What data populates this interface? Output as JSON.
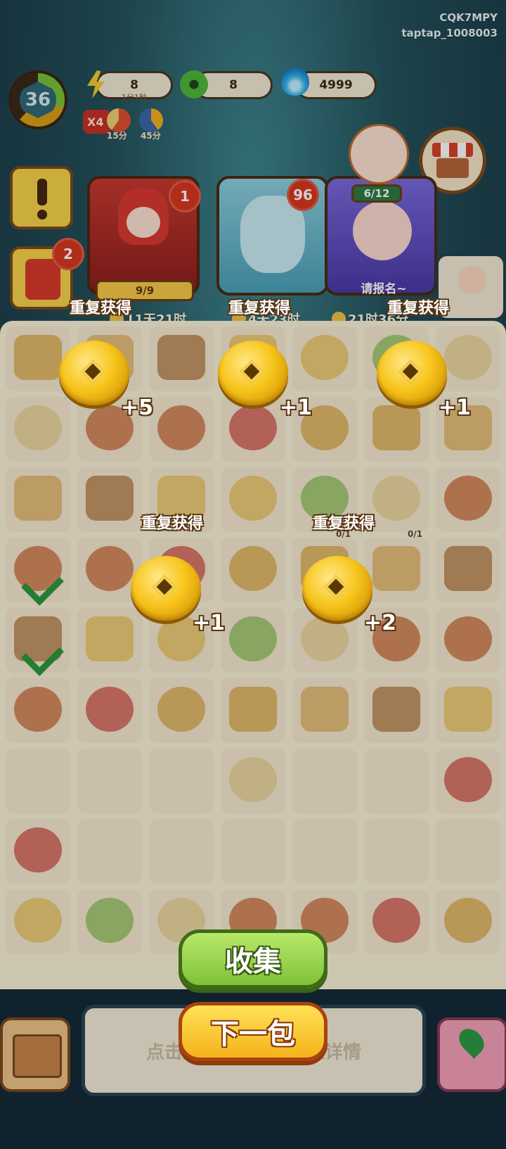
{
  "account": {
    "code": "CQK7MPY",
    "user": "taptap_1008003"
  },
  "hud": {
    "level": "36",
    "energy": {
      "value": "8",
      "timer": "1分1秒"
    },
    "jade": {
      "value": "8"
    },
    "flame": {
      "value": "4999"
    },
    "boosts": {
      "multiplier": "X4",
      "boost1": "15分",
      "boost2": "45分"
    }
  },
  "side": {
    "quest_badge": "",
    "gift_badge": "2"
  },
  "cards": [
    {
      "badge": "1",
      "progress": "9/9",
      "timer": "11天21时"
    },
    {
      "badge": "96",
      "progress": "",
      "timer": "4天23时"
    },
    {
      "badge": "",
      "progress": "6/12",
      "label": "请报名~",
      "timer": "21时36分"
    }
  ],
  "board_items": {
    "counter1": "0/1",
    "counter2": "0/1"
  },
  "rewards": [
    {
      "label": "重复获得",
      "count": "+5"
    },
    {
      "label": "重复获得",
      "count": "+1"
    },
    {
      "label": "重复获得",
      "count": "+1"
    },
    {
      "label": "重复获得",
      "count": "+1"
    },
    {
      "label": "重复获得",
      "count": "+2"
    }
  ],
  "bottom": {
    "hint": "点击道",
    "hint_right": "应详情"
  },
  "buttons": {
    "collect": "收集",
    "next": "下一包"
  },
  "colors": {
    "coin": "#f7c51c",
    "collect": "#7fc23a",
    "next": "#f5b21c",
    "board": "#fbf2d8"
  }
}
